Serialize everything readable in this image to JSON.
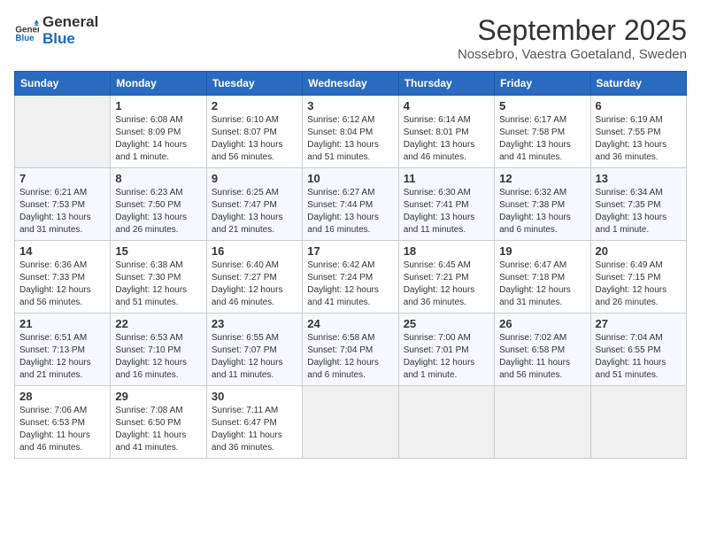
{
  "logo": {
    "line1": "General",
    "line2": "Blue"
  },
  "title": "September 2025",
  "subtitle": "Nossebro, Vaestra Goetaland, Sweden",
  "weekdays": [
    "Sunday",
    "Monday",
    "Tuesday",
    "Wednesday",
    "Thursday",
    "Friday",
    "Saturday"
  ],
  "weeks": [
    [
      {
        "day": "",
        "info": ""
      },
      {
        "day": "1",
        "info": "Sunrise: 6:08 AM\nSunset: 8:09 PM\nDaylight: 14 hours\nand 1 minute."
      },
      {
        "day": "2",
        "info": "Sunrise: 6:10 AM\nSunset: 8:07 PM\nDaylight: 13 hours\nand 56 minutes."
      },
      {
        "day": "3",
        "info": "Sunrise: 6:12 AM\nSunset: 8:04 PM\nDaylight: 13 hours\nand 51 minutes."
      },
      {
        "day": "4",
        "info": "Sunrise: 6:14 AM\nSunset: 8:01 PM\nDaylight: 13 hours\nand 46 minutes."
      },
      {
        "day": "5",
        "info": "Sunrise: 6:17 AM\nSunset: 7:58 PM\nDaylight: 13 hours\nand 41 minutes."
      },
      {
        "day": "6",
        "info": "Sunrise: 6:19 AM\nSunset: 7:55 PM\nDaylight: 13 hours\nand 36 minutes."
      }
    ],
    [
      {
        "day": "7",
        "info": "Sunrise: 6:21 AM\nSunset: 7:53 PM\nDaylight: 13 hours\nand 31 minutes."
      },
      {
        "day": "8",
        "info": "Sunrise: 6:23 AM\nSunset: 7:50 PM\nDaylight: 13 hours\nand 26 minutes."
      },
      {
        "day": "9",
        "info": "Sunrise: 6:25 AM\nSunset: 7:47 PM\nDaylight: 13 hours\nand 21 minutes."
      },
      {
        "day": "10",
        "info": "Sunrise: 6:27 AM\nSunset: 7:44 PM\nDaylight: 13 hours\nand 16 minutes."
      },
      {
        "day": "11",
        "info": "Sunrise: 6:30 AM\nSunset: 7:41 PM\nDaylight: 13 hours\nand 11 minutes."
      },
      {
        "day": "12",
        "info": "Sunrise: 6:32 AM\nSunset: 7:38 PM\nDaylight: 13 hours\nand 6 minutes."
      },
      {
        "day": "13",
        "info": "Sunrise: 6:34 AM\nSunset: 7:35 PM\nDaylight: 13 hours\nand 1 minute."
      }
    ],
    [
      {
        "day": "14",
        "info": "Sunrise: 6:36 AM\nSunset: 7:33 PM\nDaylight: 12 hours\nand 56 minutes."
      },
      {
        "day": "15",
        "info": "Sunrise: 6:38 AM\nSunset: 7:30 PM\nDaylight: 12 hours\nand 51 minutes."
      },
      {
        "day": "16",
        "info": "Sunrise: 6:40 AM\nSunset: 7:27 PM\nDaylight: 12 hours\nand 46 minutes."
      },
      {
        "day": "17",
        "info": "Sunrise: 6:42 AM\nSunset: 7:24 PM\nDaylight: 12 hours\nand 41 minutes."
      },
      {
        "day": "18",
        "info": "Sunrise: 6:45 AM\nSunset: 7:21 PM\nDaylight: 12 hours\nand 36 minutes."
      },
      {
        "day": "19",
        "info": "Sunrise: 6:47 AM\nSunset: 7:18 PM\nDaylight: 12 hours\nand 31 minutes."
      },
      {
        "day": "20",
        "info": "Sunrise: 6:49 AM\nSunset: 7:15 PM\nDaylight: 12 hours\nand 26 minutes."
      }
    ],
    [
      {
        "day": "21",
        "info": "Sunrise: 6:51 AM\nSunset: 7:13 PM\nDaylight: 12 hours\nand 21 minutes."
      },
      {
        "day": "22",
        "info": "Sunrise: 6:53 AM\nSunset: 7:10 PM\nDaylight: 12 hours\nand 16 minutes."
      },
      {
        "day": "23",
        "info": "Sunrise: 6:55 AM\nSunset: 7:07 PM\nDaylight: 12 hours\nand 11 minutes."
      },
      {
        "day": "24",
        "info": "Sunrise: 6:58 AM\nSunset: 7:04 PM\nDaylight: 12 hours\nand 6 minutes."
      },
      {
        "day": "25",
        "info": "Sunrise: 7:00 AM\nSunset: 7:01 PM\nDaylight: 12 hours\nand 1 minute."
      },
      {
        "day": "26",
        "info": "Sunrise: 7:02 AM\nSunset: 6:58 PM\nDaylight: 11 hours\nand 56 minutes."
      },
      {
        "day": "27",
        "info": "Sunrise: 7:04 AM\nSunset: 6:55 PM\nDaylight: 11 hours\nand 51 minutes."
      }
    ],
    [
      {
        "day": "28",
        "info": "Sunrise: 7:06 AM\nSunset: 6:53 PM\nDaylight: 11 hours\nand 46 minutes."
      },
      {
        "day": "29",
        "info": "Sunrise: 7:08 AM\nSunset: 6:50 PM\nDaylight: 11 hours\nand 41 minutes."
      },
      {
        "day": "30",
        "info": "Sunrise: 7:11 AM\nSunset: 6:47 PM\nDaylight: 11 hours\nand 36 minutes."
      },
      {
        "day": "",
        "info": ""
      },
      {
        "day": "",
        "info": ""
      },
      {
        "day": "",
        "info": ""
      },
      {
        "day": "",
        "info": ""
      }
    ]
  ]
}
